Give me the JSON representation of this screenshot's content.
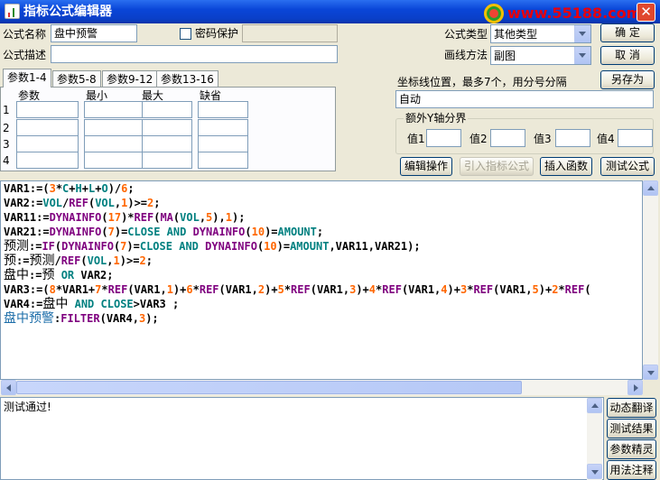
{
  "window": {
    "title": "指标公式编辑器",
    "close_glyph": "✕"
  },
  "watermark": {
    "text": "www.55188.com"
  },
  "form": {
    "name_label": "公式名称",
    "name_value": "盘中预警",
    "password_label": "密码保护",
    "password_checked": false,
    "password_value": "",
    "desc_label": "公式描述",
    "desc_value": "",
    "type_label": "公式类型",
    "type_value": "其他类型",
    "draw_label": "画线方法",
    "draw_value": "副图"
  },
  "buttons": {
    "ok": "确  定",
    "cancel": "取  消",
    "save_as": "另存为",
    "edit_ops": "编辑操作",
    "import": "引入指标公式",
    "insert_func": "插入函数",
    "test": "测试公式"
  },
  "params": {
    "tabs": [
      "参数1-4",
      "参数5-8",
      "参数9-12",
      "参数13-16"
    ],
    "active_tab": 0,
    "headers": [
      "参数",
      "最小",
      "最大",
      "缺省"
    ],
    "rows": [
      {
        "num": "1",
        "cells": [
          "",
          "",
          "",
          ""
        ]
      },
      {
        "num": "2",
        "cells": [
          "",
          "",
          "",
          ""
        ]
      },
      {
        "num": "3",
        "cells": [
          "",
          "",
          "",
          ""
        ]
      },
      {
        "num": "4",
        "cells": [
          "",
          "",
          "",
          ""
        ]
      }
    ]
  },
  "coord": {
    "label": "坐标线位置，最多7个，用分号分隔",
    "value": "自动"
  },
  "extra_axis": {
    "label": "额外Y轴分界",
    "values": [
      {
        "label": "值1",
        "value": ""
      },
      {
        "label": "值2",
        "value": ""
      },
      {
        "label": "值3",
        "value": ""
      },
      {
        "label": "值4",
        "value": ""
      }
    ]
  },
  "code": [
    "VAR1:=(3*C+H+L+O)/6;",
    "VAR2:=VOL/REF(VOL,1)>=2;",
    "VAR11:=DYNAINFO(17)*REF(MA(VOL,5),1);",
    "VAR21:=DYNAINFO(7)=CLOSE AND DYNAINFO(10)=AMOUNT;",
    "预测:=IF(DYNAINFO(7)=CLOSE AND DYNAINFO(10)=AMOUNT,VAR11,VAR21);",
    "预:=预测/REF(VOL,1)>=2;",
    "盘中:=预 OR VAR2;",
    "VAR3:=(8*VAR1+7*REF(VAR1,1)+6*REF(VAR1,2)+5*REF(VAR1,3)+4*REF(VAR1,4)+3*REF(VAR1,5)+2*REF(",
    "VAR4:=盘中 AND CLOSE>VAR3 ;",
    "盘中预警:FILTER(VAR4,3);"
  ],
  "output": {
    "text": "测试通过!"
  },
  "side_buttons": [
    "动态翻译",
    "测试结果",
    "参数精灵",
    "用法注释"
  ],
  "colors": {
    "title_blue": "#0a46d8",
    "code_number": "#ff6600",
    "code_keyword": "#008080",
    "code_function": "#7f007f",
    "code_output_name": "#1a6ca8",
    "watermark": "#e8000b"
  }
}
